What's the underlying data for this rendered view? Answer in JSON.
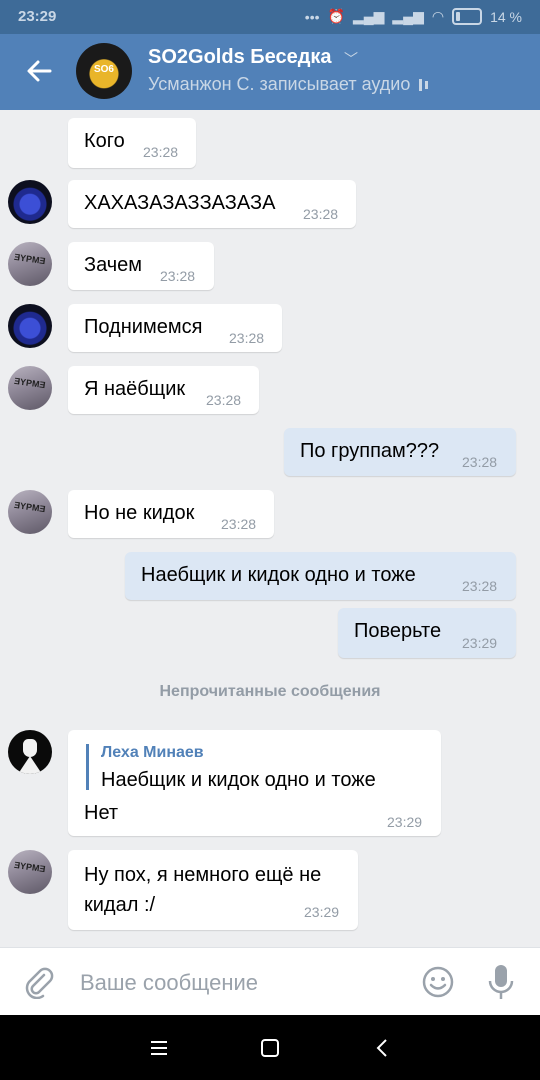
{
  "status_bar": {
    "time": "23:29",
    "battery": "14 %"
  },
  "header": {
    "title": "SO2Golds Беседка",
    "subtitle": "Усманжон С. записывает аудио",
    "avatar_text": "SO6"
  },
  "messages": [
    {
      "text": "Кого",
      "time": "23:28",
      "avatar": "none"
    },
    {
      "text": "ХАХАЗАЗАЗЗАЗАЗА",
      "time": "23:28",
      "avatar": "wolf"
    },
    {
      "text": "Зачем",
      "time": "23:28",
      "avatar": "shirt"
    },
    {
      "text": "Поднимемся",
      "time": "23:28",
      "avatar": "wolf"
    },
    {
      "text": "Я наёбщик",
      "time": "23:28",
      "avatar": "shirt"
    },
    {
      "text": "По группам???",
      "time": "23:28",
      "outgoing": true
    },
    {
      "text": "Но не кидок",
      "time": "23:28",
      "avatar": "shirt"
    },
    {
      "text": "Наебщик и кидок одно и тоже",
      "time": "23:28",
      "outgoing": true
    },
    {
      "text": "Поверьте",
      "time": "23:29",
      "outgoing": true
    }
  ],
  "avatar_shirt_text": "ƎYPMƎ",
  "unread_label": "Непрочитанные сообщения",
  "reply_message": {
    "reply_author": "Леха Минаев",
    "reply_text": "Наебщик и кидок одно и тоже",
    "text": "Нет",
    "time": "23:29",
    "avatar": "mask"
  },
  "last_message": {
    "line1": "Ну пох, я немного ещё не",
    "line2": "кидал :/",
    "time": "23:29",
    "avatar": "shirt"
  },
  "composer": {
    "placeholder": "Ваше сообщение"
  },
  "colors": {
    "header": "#5181b8",
    "status_bar": "#3e6b98",
    "background": "#edeef0",
    "incoming_bubble": "#ffffff",
    "outgoing_bubble": "#dce7f4",
    "time_text": "#939ca6"
  }
}
